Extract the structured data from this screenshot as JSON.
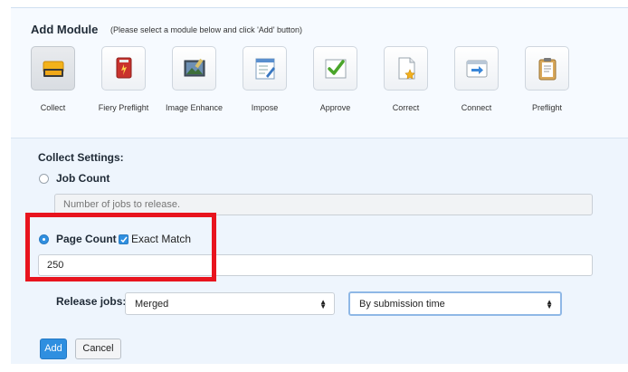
{
  "header": {
    "title": "Add Module",
    "hint": "(Please select a module below and click 'Add' button)"
  },
  "modules": [
    {
      "label": "Collect",
      "icon": "collect-icon",
      "selected": true
    },
    {
      "label": "Fiery Preflight",
      "icon": "fiery-preflight-icon",
      "selected": false
    },
    {
      "label": "Image Enhance",
      "icon": "image-enhance-icon",
      "selected": false
    },
    {
      "label": "Impose",
      "icon": "impose-icon",
      "selected": false
    },
    {
      "label": "Approve",
      "icon": "approve-icon",
      "selected": false
    },
    {
      "label": "Correct",
      "icon": "correct-icon",
      "selected": false
    },
    {
      "label": "Connect",
      "icon": "connect-icon",
      "selected": false
    },
    {
      "label": "Preflight",
      "icon": "preflight-icon",
      "selected": false
    }
  ],
  "settings": {
    "title": "Collect Settings:",
    "job_count": {
      "label": "Job Count",
      "selected": false,
      "placeholder": "Number of jobs to release.",
      "value": ""
    },
    "page_count": {
      "label": "Page Count",
      "selected": true,
      "exact_match_label": "Exact Match",
      "exact_match_checked": true,
      "value": "250"
    },
    "release_jobs": {
      "label": "Release jobs:",
      "mode": "Merged",
      "order": "By submission time"
    }
  },
  "buttons": {
    "add": "Add",
    "cancel": "Cancel"
  },
  "colors": {
    "accent": "#2f8fe0",
    "annotation": "#e8141e",
    "panel_bg": "#eef5fd"
  }
}
